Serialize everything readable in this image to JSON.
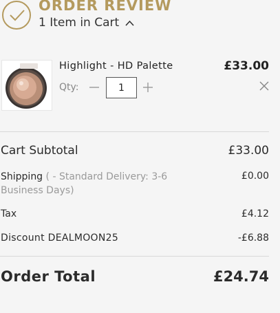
{
  "header": {
    "title": "ORDER REVIEW",
    "cart_summary": "1 Item in Cart"
  },
  "items": [
    {
      "name": "Highlight - HD Palette",
      "price": "£33.00",
      "qty_label": "Qty:",
      "quantity": "1"
    }
  ],
  "totals": {
    "subtotal_label": "Cart Subtotal",
    "subtotal_value": "£33.00",
    "shipping_label": "Shipping",
    "shipping_method": "( - Standard Delivery: 3-6 Business Days)",
    "shipping_value": "£0.00",
    "tax_label": "Tax",
    "tax_value": "£4.12",
    "discount_label": "Discount DEALMOON25",
    "discount_value": "-£6.88",
    "total_label": "Order Total",
    "total_value": "£24.74"
  },
  "colors": {
    "accent": "#b49a5e",
    "background": "#f5f5f5",
    "divider": "#d8d8d8"
  },
  "icons": {
    "header": "check-circle-icon",
    "toggle": "chevron-up-icon",
    "decrement": "minus-icon",
    "increment": "plus-icon",
    "remove": "close-icon"
  }
}
